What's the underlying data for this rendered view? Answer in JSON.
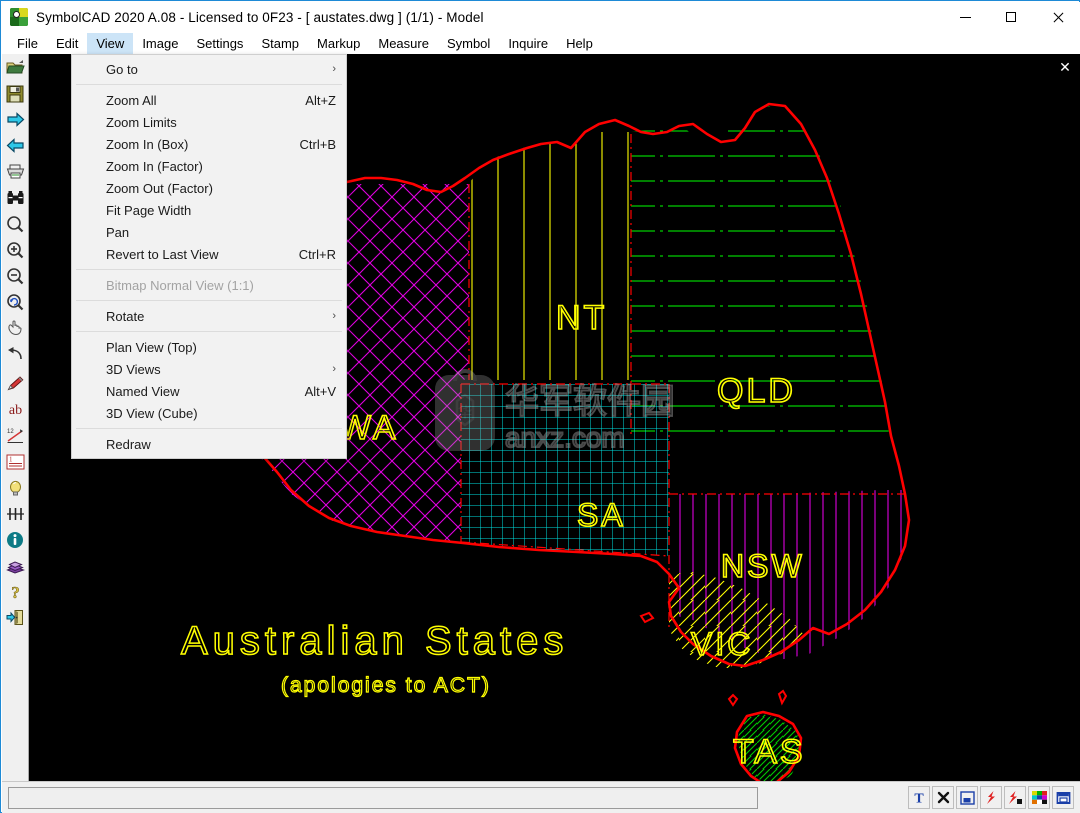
{
  "window": {
    "title": "SymbolCAD 2020 A.08 - Licensed to 0F23  -  [ austates.dwg ] (1/1)  -  Model",
    "app_icon": "symbolcad-icon",
    "controls": {
      "minimize": "–",
      "maximize": "□",
      "close": "✕"
    }
  },
  "menubar": {
    "items": [
      {
        "label": "File",
        "active": false
      },
      {
        "label": "Edit",
        "active": false
      },
      {
        "label": "View",
        "active": true
      },
      {
        "label": "Image",
        "active": false
      },
      {
        "label": "Settings",
        "active": false
      },
      {
        "label": "Stamp",
        "active": false
      },
      {
        "label": "Markup",
        "active": false
      },
      {
        "label": "Measure",
        "active": false
      },
      {
        "label": "Symbol",
        "active": false
      },
      {
        "label": "Inquire",
        "active": false
      },
      {
        "label": "Help",
        "active": false
      }
    ]
  },
  "view_menu": {
    "items": [
      {
        "label": "Go to",
        "accel": "",
        "submenu": true,
        "disabled": false,
        "sep_after": true
      },
      {
        "label": "Zoom All",
        "accel": "Alt+Z",
        "submenu": false,
        "disabled": false,
        "sep_after": false
      },
      {
        "label": "Zoom Limits",
        "accel": "",
        "submenu": false,
        "disabled": false,
        "sep_after": false
      },
      {
        "label": "Zoom In (Box)",
        "accel": "Ctrl+B",
        "submenu": false,
        "disabled": false,
        "sep_after": false
      },
      {
        "label": "Zoom In (Factor)",
        "accel": "",
        "submenu": false,
        "disabled": false,
        "sep_after": false
      },
      {
        "label": "Zoom Out (Factor)",
        "accel": "",
        "submenu": false,
        "disabled": false,
        "sep_after": false
      },
      {
        "label": "Fit Page Width",
        "accel": "",
        "submenu": false,
        "disabled": false,
        "sep_after": false
      },
      {
        "label": "Pan",
        "accel": "",
        "submenu": false,
        "disabled": false,
        "sep_after": false
      },
      {
        "label": "Revert to Last View",
        "accel": "Ctrl+R",
        "submenu": false,
        "disabled": false,
        "sep_after": true
      },
      {
        "label": "Bitmap Normal View (1:1)",
        "accel": "",
        "submenu": false,
        "disabled": true,
        "sep_after": true
      },
      {
        "label": "Rotate",
        "accel": "",
        "submenu": true,
        "disabled": false,
        "sep_after": true
      },
      {
        "label": "Plan View (Top)",
        "accel": "",
        "submenu": false,
        "disabled": false,
        "sep_after": false
      },
      {
        "label": "3D Views",
        "accel": "",
        "submenu": true,
        "disabled": false,
        "sep_after": false
      },
      {
        "label": "Named View",
        "accel": "Alt+V",
        "submenu": false,
        "disabled": false,
        "sep_after": false
      },
      {
        "label": "3D View (Cube)",
        "accel": "",
        "submenu": false,
        "disabled": false,
        "sep_after": true
      },
      {
        "label": "Redraw",
        "accel": "",
        "submenu": false,
        "disabled": false,
        "sep_after": false
      }
    ]
  },
  "toolbar": {
    "buttons": [
      {
        "name": "open-file-icon"
      },
      {
        "name": "save-icon"
      },
      {
        "name": "next-page-icon"
      },
      {
        "name": "previous-page-icon"
      },
      {
        "name": "print-icon"
      },
      {
        "name": "binoculars-icon"
      },
      {
        "name": "zoom-window-icon"
      },
      {
        "name": "zoom-in-icon"
      },
      {
        "name": "zoom-out-icon"
      },
      {
        "name": "zoom-previous-icon"
      },
      {
        "name": "pan-hand-icon"
      },
      {
        "name": "undo-icon"
      },
      {
        "name": "pencil-markup-icon"
      },
      {
        "name": "text-ab-icon"
      },
      {
        "name": "measure-distance-icon"
      },
      {
        "name": "line-style-icon"
      },
      {
        "name": "highlight-bulb-icon"
      },
      {
        "name": "settings-sliders-icon"
      },
      {
        "name": "info-icon"
      },
      {
        "name": "reference-book-icon"
      },
      {
        "name": "help-question-icon"
      },
      {
        "name": "exit-door-icon"
      }
    ]
  },
  "canvas": {
    "close_label": "✕",
    "background": "#000000",
    "watermark": {
      "text_cn": "华军软件园",
      "text_en": "anxz.com"
    },
    "drawing": {
      "title": "Australian  States",
      "subtitle": "(apologies to ACT)",
      "title_color": "#ffff00",
      "coastline_color": "#ff0000",
      "states": [
        {
          "code": "WA",
          "label": "WA",
          "hatch": "cross-diagonal",
          "hatch_color": "#ff00ff",
          "label_color": "#ffff00"
        },
        {
          "code": "NT",
          "label": "NT",
          "hatch": "vertical",
          "hatch_color": "#ffff00",
          "label_color": "#ffff00"
        },
        {
          "code": "QLD",
          "label": "QLD",
          "hatch": "horizontal-dashdot",
          "hatch_color": "#00cc00",
          "label_color": "#ffff00"
        },
        {
          "code": "SA",
          "label": "SA",
          "hatch": "grid",
          "hatch_color": "#00e5e5",
          "label_color": "#ffff00"
        },
        {
          "code": "NSW",
          "label": "NSW",
          "hatch": "vertical",
          "hatch_color": "#cc00cc",
          "label_color": "#ffff00"
        },
        {
          "code": "VIC",
          "label": "VIC",
          "hatch": "diagonal",
          "hatch_color": "#ffff00",
          "label_color": "#ffff00"
        },
        {
          "code": "TAS",
          "label": "TAS",
          "hatch": "diagonal",
          "hatch_color": "#00cc00",
          "label_color": "#ffff00"
        }
      ]
    }
  },
  "statusbar": {
    "command_value": "",
    "command_placeholder": "",
    "buttons": [
      {
        "name": "text-tool-icon",
        "glyph": "T"
      },
      {
        "name": "delete-tool-icon",
        "glyph": "✕"
      },
      {
        "name": "window-tile-icon",
        "glyph": "▣"
      },
      {
        "name": "lightning-icon",
        "glyph": "ϟ"
      },
      {
        "name": "lightning-fill-icon",
        "glyph": "ϟ"
      },
      {
        "name": "color-palette-icon",
        "glyph": "▦"
      },
      {
        "name": "layers-icon",
        "glyph": "▤"
      }
    ]
  }
}
